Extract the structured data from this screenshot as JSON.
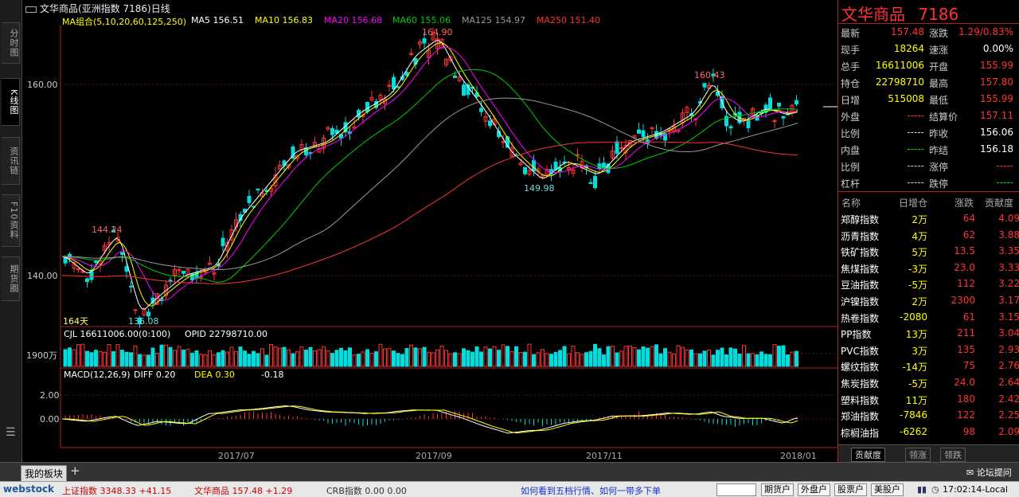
{
  "sidebar": {
    "tabs": [
      "分时图",
      "K线图",
      "资讯链",
      "F10资料",
      "期货圈"
    ],
    "active": 1
  },
  "header": {
    "title": "文华商品(亚洲指数 7186)日线"
  },
  "ma_legend": {
    "combo": "MA组合(5,10,20,60,125,250)",
    "ma5": "MA5 156.51",
    "ma10": "MA10 156.83",
    "ma20": "MA20 156.68",
    "ma60": "MA60 155.06",
    "ma125": "MA125 154.97",
    "ma250": "MA250 151.40"
  },
  "colors": {
    "ma5": "#ffffff",
    "ma10": "#ffff00",
    "ma20": "#ff00ff",
    "ma60": "#00cc00",
    "ma125": "#999999",
    "ma250": "#ff3333",
    "up": "#ff3333",
    "down": "#00dddd",
    "volume_up": "#ff3333",
    "volume_down": "#00dddd"
  },
  "price_axis": {
    "labels": [
      "160.00",
      "140.00"
    ]
  },
  "annotations": {
    "high": "164.90",
    "low1": "149.98",
    "peak2": "160.43",
    "peak0": "144.24",
    "low0": "136.08",
    "days": "164天"
  },
  "volume_panel": {
    "header_cjl": "CJL  16611006.00(0:100)",
    "header_opid": "OPID  22798710.00",
    "axis_label": "1900万"
  },
  "macd_panel": {
    "header": "MACD(12,26,9)",
    "diff": "DIFF  0.20",
    "dea": "DEA  0.30",
    "macd": "-0.18",
    "axis": [
      "2.00",
      "0.00"
    ]
  },
  "x_axis": {
    "labels": [
      "2017/07",
      "2017/09",
      "2017/11",
      "2018/01"
    ]
  },
  "quote": {
    "name": "文华商品",
    "code": "7186",
    "rows": [
      {
        "l1": "最新",
        "v1": "157.48",
        "c1": "#ff3333",
        "l2": "涨跌",
        "v2": "1.29/0.83%",
        "c2": "#ff3333"
      },
      {
        "l1": "现手",
        "v1": "18264",
        "c1": "#ffff00",
        "l2": "速涨",
        "v2": "0.00%",
        "c2": "#ffffff"
      },
      {
        "l1": "总手",
        "v1": "16611006",
        "c1": "#ffff00",
        "l2": "开盘",
        "v2": "155.99",
        "c2": "#ff3333"
      },
      {
        "l1": "持仓",
        "v1": "22798710",
        "c1": "#ffff00",
        "l2": "最高",
        "v2": "157.80",
        "c2": "#ff3333"
      },
      {
        "l1": "日增",
        "v1": "515008",
        "c1": "#ffff00",
        "l2": "最低",
        "v2": "155.99",
        "c2": "#ff3333"
      },
      {
        "l1": "外盘",
        "v1": "-----",
        "c1": "#ff3333",
        "l2": "结算价",
        "v2": "157.11",
        "c2": "#ff3333"
      },
      {
        "l1": "比例",
        "v1": "-----",
        "c1": "#cccccc",
        "l2": "昨收",
        "v2": "156.06",
        "c2": "#ffffff"
      },
      {
        "l1": "内盘",
        "v1": "-----",
        "c1": "#00dd00",
        "l2": "昨结",
        "v2": "156.18",
        "c2": "#ffffff"
      },
      {
        "l1": "比例",
        "v1": "-----",
        "c1": "#cccccc",
        "l2": "涨停",
        "v2": "-----",
        "c2": "#ff3333"
      },
      {
        "l1": "杠杆",
        "v1": "-----",
        "c1": "#cccccc",
        "l2": "跌停",
        "v2": "-----",
        "c2": "#00dd00"
      }
    ],
    "table_headers": [
      "名称",
      "日增仓",
      "涨跌",
      "贡献度"
    ],
    "table_rows": [
      [
        "郑醇指数",
        "2万",
        "64",
        "4.09"
      ],
      [
        "沥青指数",
        "4万",
        "62",
        "3.88"
      ],
      [
        "铁矿指数",
        "5万",
        "13.5",
        "3.35"
      ],
      [
        "焦煤指数",
        "-3万",
        "23.0",
        "3.33"
      ],
      [
        "豆油指数",
        "-5万",
        "112",
        "3.22"
      ],
      [
        "沪镍指数",
        "2万",
        "2300",
        "3.17"
      ],
      [
        "热卷指数",
        "-2080",
        "61",
        "3.15"
      ],
      [
        "PP指数",
        "13万",
        "211",
        "3.04"
      ],
      [
        "PVC指数",
        "3万",
        "135",
        "2.93"
      ],
      [
        "螺纹指数",
        "-14万",
        "75",
        "2.76"
      ],
      [
        "焦炭指数",
        "-5万",
        "24.0",
        "2.64"
      ],
      [
        "塑料指数",
        "11万",
        "180",
        "2.42"
      ],
      [
        "郑油指数",
        "-7846",
        "122",
        "2.25"
      ],
      [
        "棕榈油指",
        "-6262",
        "98",
        "2.09"
      ]
    ],
    "bottom_tabs": [
      "贡献度",
      "领涨",
      "领跌"
    ]
  },
  "tabbar": {
    "tab": "我的板块",
    "add": "+",
    "forum": "论坛提问"
  },
  "statusbar": {
    "logo": "webstock",
    "idx1": "上证指数  3348.33 +41.15",
    "idx2": "文华商品  157.48 +1.29",
    "idx3": "CRB指数  0.00  0.00",
    "link": "如何看到五档行情、如何一带多下单",
    "btns": [
      "期货户",
      "外盘户",
      "股票户",
      "美股户"
    ],
    "time": "17:02:14-Local"
  }
}
